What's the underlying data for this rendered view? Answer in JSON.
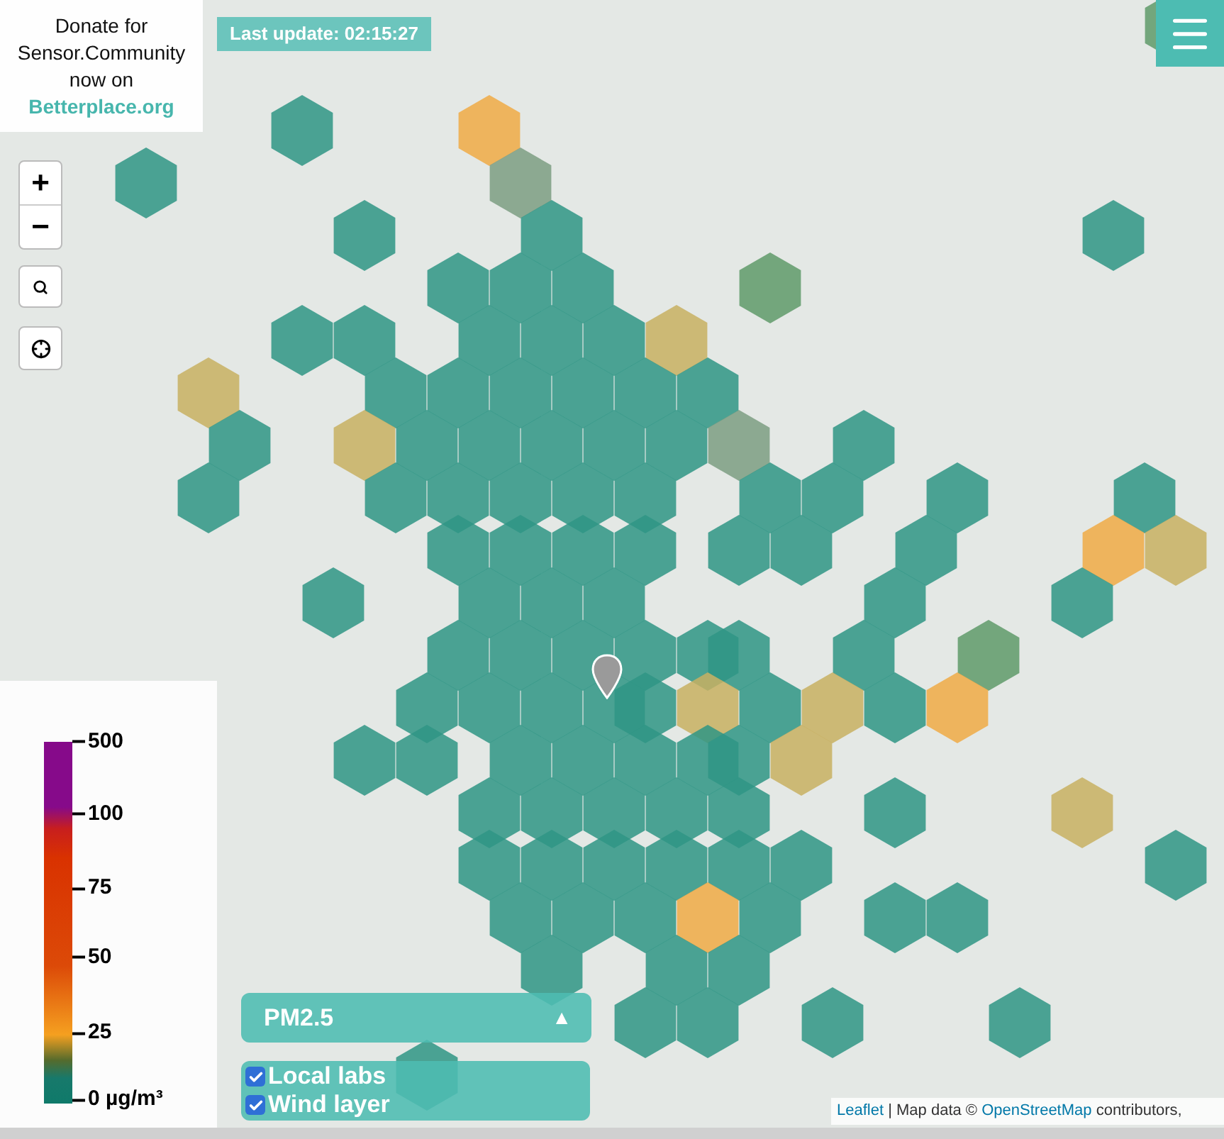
{
  "donate": {
    "text": "Donate for Sensor.Community now on",
    "link": "Betterplace.org"
  },
  "last_update": "Last update: 02:15:27",
  "zoom_controls": {
    "zoom_in": "+",
    "zoom_out": "−"
  },
  "legend": {
    "labels": [
      "500",
      "100",
      "75",
      "50",
      "25",
      "0 µg/m³"
    ]
  },
  "pollutant_select": {
    "value": "PM2.5",
    "arrow": "▲"
  },
  "layers": [
    {
      "label": "Local labs",
      "checked": true
    },
    {
      "label": "Wind layer",
      "checked": true
    }
  ],
  "attribution": {
    "link_1": "Leaflet",
    "text_1": "| Map data ©",
    "link_2": "OpenStreetMap",
    "text_2": "contributors,"
  }
}
